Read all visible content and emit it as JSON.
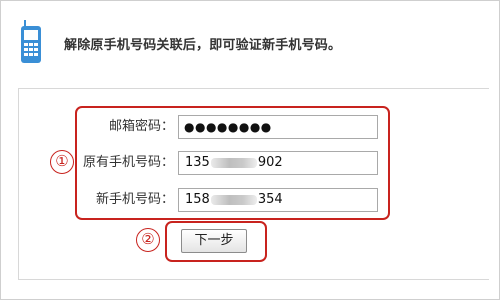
{
  "header": {
    "message": "解除原手机号码关联后，即可验证新手机号码。",
    "icon": "mobile-phone-icon",
    "icon_color": "#3a8fd6"
  },
  "form": {
    "password": {
      "label": "邮箱密码：",
      "value": "●●●●●●●●"
    },
    "old_phone": {
      "label": "原有手机号码：",
      "prefix": "135",
      "suffix": "902"
    },
    "new_phone": {
      "label": "新手机号码：",
      "prefix": "158",
      "suffix": "354"
    }
  },
  "next_button": {
    "label": "下一步"
  },
  "annotations": {
    "step1": "①",
    "step2": "②",
    "color": "#c8231e"
  }
}
